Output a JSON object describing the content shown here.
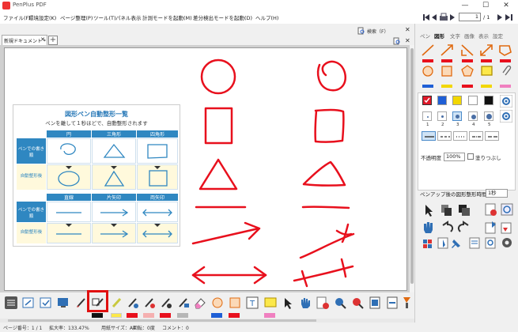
{
  "app": {
    "title": "PenPlus PDF"
  },
  "menu": [
    "ファイル(F)",
    "環境設定(K)",
    "ページ整理(P)",
    "ツール(T)",
    "パネル表示",
    "計測モードを起動(M)",
    "差分検出モードを起動(D)",
    "ヘルプ(H)"
  ],
  "nav": {
    "page_current": "1",
    "page_total": "/ 1"
  },
  "tabs": {
    "doc_tab": "新規ドキュメント *",
    "search_left": "検索（F）",
    "search_right": "検索"
  },
  "rightpanel": {
    "tabs": [
      "ペン",
      "図形",
      "文字",
      "画像",
      "表示",
      "設定"
    ],
    "active_tab": "図形",
    "opacity_label": "不透明度",
    "opacity_value": "100%",
    "fill_label": "塗りつぶし",
    "delay_label": "ペンアップ後の図形整形時間：",
    "delay_value": "1秒",
    "dot_numbers": [
      "1",
      "2",
      "3",
      "4",
      "5"
    ],
    "colors": [
      "#e0192a",
      "#1f5fd6",
      "#f2d700",
      "#ffffff",
      "#111111"
    ]
  },
  "guide": {
    "title": "図形ペン自動整形一覧",
    "subtitle": "ペンを離して１秒ほどで、自動整形されます",
    "top_headers": [
      "円",
      "三角形",
      "四角形"
    ],
    "bottom_headers": [
      "直線",
      "片矢印",
      "両矢印"
    ],
    "row_before": "ペンでの書き順",
    "row_after": "自動整形後"
  },
  "status": {
    "page": "ページ番号：1 / 1",
    "zoom": "拡大率：133.47%",
    "scale": "用紙サイズ：A4",
    "other": "回転：0度",
    "comment": "コメント：0"
  },
  "accent_colors": {
    "highlight": "#e01010",
    "drawing_red": "#e8101d"
  }
}
